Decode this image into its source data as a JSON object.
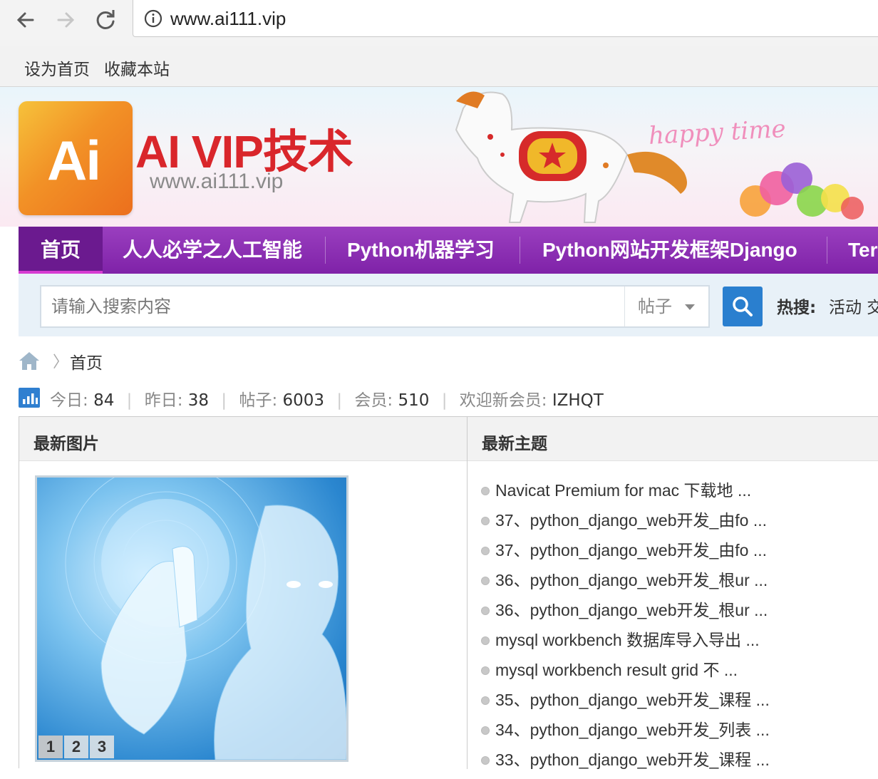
{
  "browser": {
    "url": "www.ai111.vip",
    "icons": [
      "back-icon",
      "forward-icon",
      "reload-icon",
      "info-icon"
    ]
  },
  "bookmarks": {
    "set_home": "设为首页",
    "favorite": "收藏本站"
  },
  "header": {
    "logo_text": "Ai",
    "site_title": "AI VIP技术",
    "site_domain": "www.ai111.vip",
    "banner_text": "happy time"
  },
  "nav": {
    "items": [
      {
        "label": "首页",
        "active": true
      },
      {
        "label": "人人必学之人工智能"
      },
      {
        "label": "Python机器学习"
      },
      {
        "label": "Python网站开发框架Django"
      },
      {
        "label": "Ter"
      }
    ]
  },
  "search": {
    "placeholder": "请输入搜索内容",
    "type_selected": "帖子",
    "hot_label": "热搜:",
    "hot_item": "活动 交"
  },
  "breadcrumb": {
    "current": "首页"
  },
  "stats": {
    "today_label": "今日:",
    "today": "84",
    "yesterday_label": "昨日:",
    "yesterday": "38",
    "posts_label": "帖子:",
    "posts": "6003",
    "members_label": "会员:",
    "members": "510",
    "welcome_label": "欢迎新会员:",
    "newest_member": "IZHQT"
  },
  "panels": {
    "images_title": "最新图片",
    "topics_title": "最新主题",
    "slide_pages": [
      "1",
      "2",
      "3"
    ],
    "topics": [
      "Navicat Premium for mac 下载地 ...",
      "37、python_django_web开发_由fo ...",
      "37、python_django_web开发_由fo ...",
      "36、python_django_web开发_根ur ...",
      "36、python_django_web开发_根ur ...",
      "mysql workbench 数据库导入导出 ...",
      "mysql workbench result grid 不 ...",
      "35、python_django_web开发_课程 ...",
      "34、python_django_web开发_列表 ...",
      "33、python_django_web开发_课程 ..."
    ]
  },
  "colors": {
    "nav_purple": "#8a2db5",
    "title_red": "#d9262b",
    "search_blue": "#2a7fcf"
  }
}
